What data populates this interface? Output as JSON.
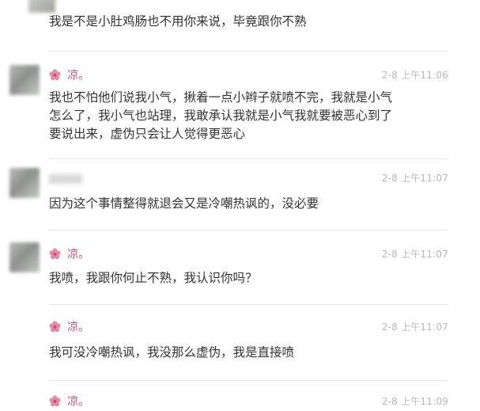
{
  "colors": {
    "username": "#d24a75",
    "timestamp": "#b8b8b8",
    "text": "#333333",
    "divider": "#e6e6e6"
  },
  "comments": [
    {
      "user": "",
      "time": "",
      "text": "我是不是小肚鸡肠也不用你来说，毕竟跟你不熟"
    },
    {
      "user": "凉。",
      "time": "2-8 上午11:06",
      "text_lines": [
        "我也不怕他们说我小气，揪着一点小辫子就喷不完，我就是小气",
        "怎么了，我小气也站理，我敢承认我就是小气我就要被恶心到了",
        "要说出来，虚伪只会让人觉得更恶心"
      ]
    },
    {
      "user": "",
      "time": "2-8 上午11:07",
      "text": "因为这个事情整得就退会又是冷嘲热讽的，没必要"
    },
    {
      "user": "凉。",
      "time": "2-8 上午11:07",
      "text": "我喷，我跟你何止不熟，我认识你吗？"
    },
    {
      "user": "凉。",
      "time": "2-8 上午11:07",
      "text": "我可没冷嘲热讽，我没那么虚伪，我是直接喷"
    },
    {
      "user": "凉。",
      "time": "2-8 上午11:09",
      "text": ""
    }
  ]
}
